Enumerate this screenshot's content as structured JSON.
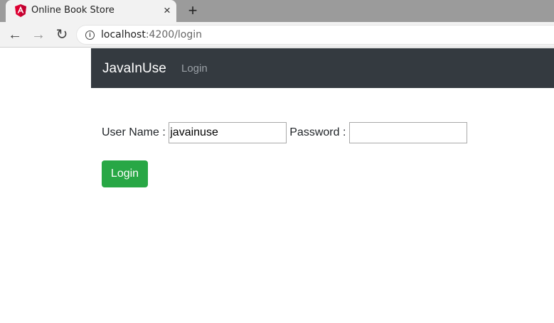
{
  "browser": {
    "tab": {
      "title": "Online Book Store",
      "favicon": "angular-logo-icon",
      "close_icon": "×"
    },
    "new_tab_icon": "+",
    "nav": {
      "back_icon": "←",
      "forward_icon": "→",
      "reload_icon": "↻"
    },
    "address": {
      "host": "localhost",
      "path": ":4200/login",
      "info_icon": "i"
    }
  },
  "navbar": {
    "brand": "JavaInUse",
    "links": [
      {
        "label": "Login"
      }
    ]
  },
  "form": {
    "username": {
      "label": "User Name : ",
      "value": "javainuse"
    },
    "password": {
      "label": "Password : ",
      "value": ""
    },
    "submit_label": "Login"
  },
  "colors": {
    "navbar": "#343a40",
    "button": "#28a745",
    "tabstrip": "#9b9b9b"
  }
}
